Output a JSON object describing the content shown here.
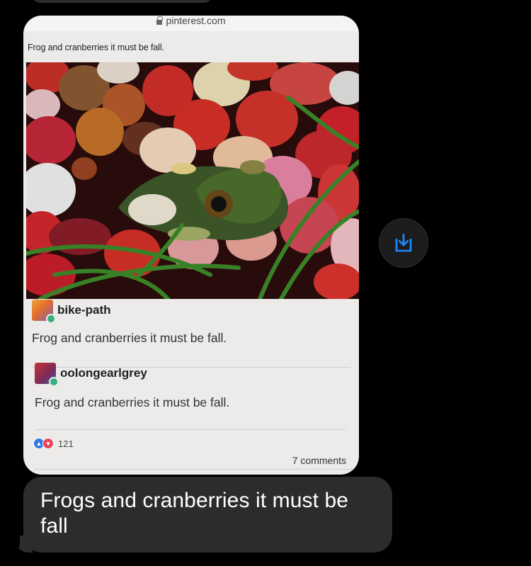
{
  "shared_post": {
    "url": "pinterest.com",
    "title": "Frog and cranberries it must be fall.",
    "posts": [
      {
        "user": "bike-path",
        "text": "Frog and cranberries it must be fall."
      },
      {
        "user": "oolongearlgrey",
        "text": "Frog and cranberries it must be fall."
      }
    ],
    "reaction_count": "121",
    "comments_label": "7 comments"
  },
  "message": {
    "text": "Frogs and cranberries it must be fall"
  },
  "icons": {
    "save": "save-to-device-icon",
    "lock": "lock-icon"
  },
  "colors": {
    "background": "#000000",
    "bubble": "#2c2c2e",
    "save_icon": "#1a8cff",
    "like": "#3578e5",
    "love": "#e8475a"
  }
}
